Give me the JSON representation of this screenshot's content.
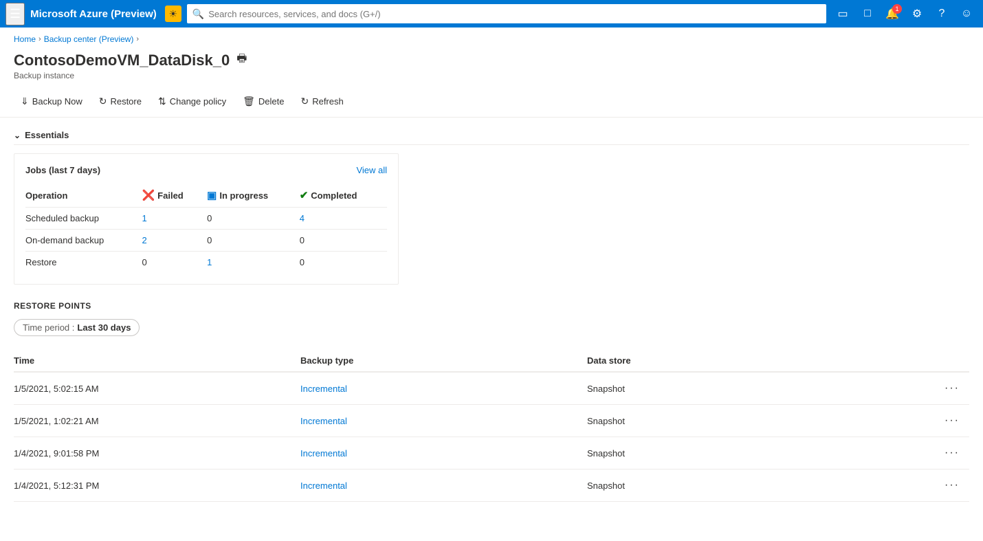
{
  "topbar": {
    "title": "Microsoft Azure (Preview)",
    "search_placeholder": "Search resources, services, and docs (G+/)",
    "icon": "☀"
  },
  "breadcrumb": {
    "items": [
      "Home",
      "Backup center (Preview)"
    ]
  },
  "page": {
    "title": "ContosoDemoVM_DataDisk_0",
    "subtitle": "Backup instance",
    "print_label": "Print"
  },
  "toolbar": {
    "backup_now": "Backup Now",
    "restore": "Restore",
    "change_policy": "Change policy",
    "delete": "Delete",
    "refresh": "Refresh"
  },
  "essentials": {
    "label": "Essentials"
  },
  "jobs": {
    "title": "Jobs (last 7 days)",
    "view_all": "View all",
    "columns": {
      "operation": "Operation",
      "failed": "Failed",
      "in_progress": "In progress",
      "completed": "Completed"
    },
    "rows": [
      {
        "operation": "Scheduled backup",
        "failed": "1",
        "in_progress": "0",
        "completed": "4",
        "failed_link": true,
        "completed_link": true
      },
      {
        "operation": "On-demand backup",
        "failed": "2",
        "in_progress": "0",
        "completed": "0",
        "failed_link": true,
        "completed_link": false
      },
      {
        "operation": "Restore",
        "failed": "0",
        "in_progress": "1",
        "completed": "0",
        "failed_link": false,
        "completed_link": false,
        "in_progress_link": true
      }
    ]
  },
  "restore_points": {
    "section_title": "RESTORE POINTS",
    "time_period_label": "Time period",
    "time_period_value": "Last 30 days",
    "columns": {
      "time": "Time",
      "backup_type": "Backup type",
      "data_store": "Data store"
    },
    "rows": [
      {
        "time": "1/5/2021, 5:02:15 AM",
        "backup_type": "Incremental",
        "data_store": "Snapshot"
      },
      {
        "time": "1/5/2021, 1:02:21 AM",
        "backup_type": "Incremental",
        "data_store": "Snapshot"
      },
      {
        "time": "1/4/2021, 9:01:58 PM",
        "backup_type": "Incremental",
        "data_store": "Snapshot"
      },
      {
        "time": "1/4/2021, 5:12:31 PM",
        "backup_type": "Incremental",
        "data_store": "Snapshot"
      }
    ]
  }
}
